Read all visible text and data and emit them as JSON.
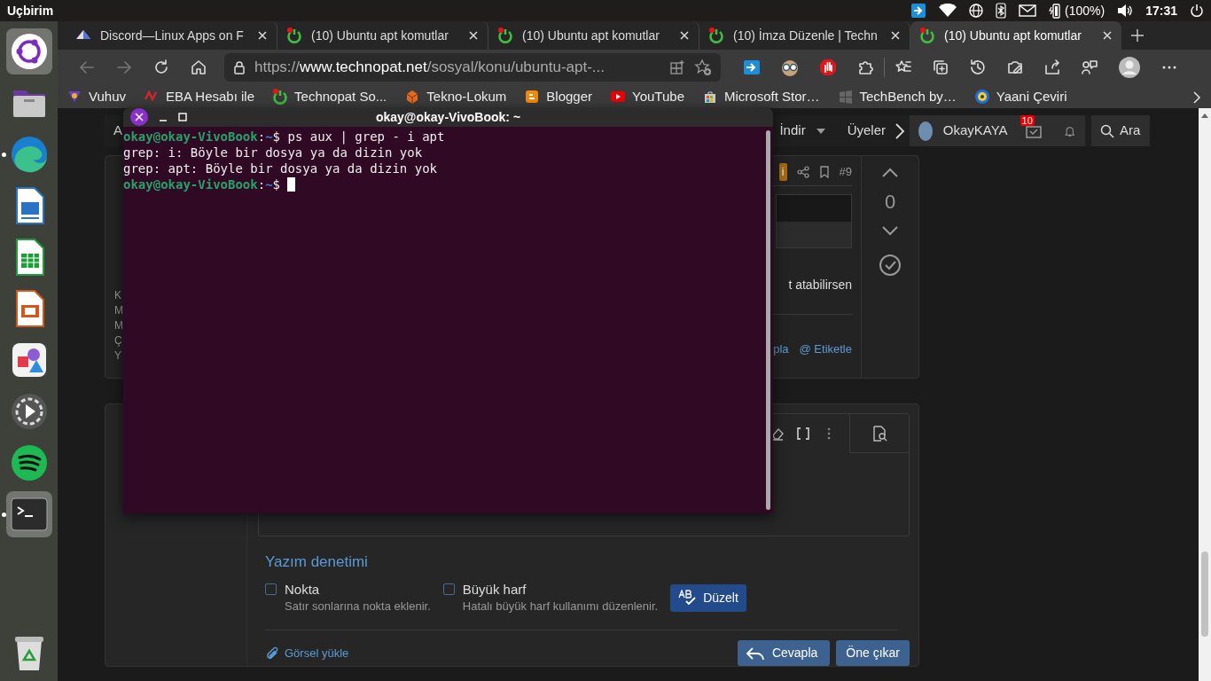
{
  "top_bar": {
    "app_title": "Uçbirim",
    "battery": "(100%)",
    "clock": "17:31"
  },
  "dock": [
    {
      "kind": "ring",
      "selected": true,
      "running": false
    },
    {
      "kind": "folder",
      "selected": false,
      "running": false
    },
    {
      "kind": "swirl",
      "selected": false,
      "running": true
    },
    {
      "kind": "writer",
      "selected": false,
      "running": false
    },
    {
      "kind": "calc",
      "selected": false,
      "running": false
    },
    {
      "kind": "impress",
      "selected": false,
      "running": false
    },
    {
      "kind": "shapes",
      "selected": false,
      "running": false
    },
    {
      "kind": "player",
      "selected": false,
      "running": false
    },
    {
      "kind": "music",
      "selected": false,
      "running": false
    },
    {
      "kind": "terminal",
      "selected": true,
      "running": true
    },
    {
      "kind": "trash",
      "selected": false,
      "running": false
    }
  ],
  "browser": {
    "tabs": [
      {
        "title": "Discord—Linux Apps on F",
        "kind": "store",
        "selected": false
      },
      {
        "title": "(10) Ubuntu apt komutlar",
        "kind": "forum",
        "selected": false
      },
      {
        "title": "(10) Ubuntu apt komutlar",
        "kind": "forum",
        "selected": false
      },
      {
        "title": "(10) İmza Düzenle | Techn",
        "kind": "forum",
        "selected": false
      },
      {
        "title": "(10) Ubuntu apt komutlar",
        "kind": "forum",
        "selected": true
      }
    ],
    "address": {
      "scheme": "https://",
      "host": "www.technopat.net",
      "path": "/sosyal/konu/ubuntu-apt-..."
    },
    "bookmarks": [
      {
        "label": "Vuhuv",
        "kind": "vuhuv"
      },
      {
        "label": "EBA Hesabı ile",
        "kind": "eba"
      },
      {
        "label": "Technopat So...",
        "kind": "forum"
      },
      {
        "label": "Tekno-Lokum",
        "kind": "box"
      },
      {
        "label": "Blogger",
        "kind": "blogger"
      },
      {
        "label": "YouTube",
        "kind": "youtube"
      },
      {
        "label": "Microsoft Stor…",
        "kind": "store"
      },
      {
        "label": "TechBench by…",
        "kind": "windows"
      },
      {
        "label": "Yaani Çeviri",
        "kind": "yaani"
      }
    ]
  },
  "site": {
    "nav": [
      {
        "label": "A",
        "dropdown": false
      },
      {
        "label": "İndir",
        "dropdown": true
      },
      {
        "label": "Üyeler",
        "dropdown": false
      }
    ],
    "user": {
      "name": "OkayKAYA",
      "badge": "10"
    },
    "search": "Ara",
    "post": {
      "user_info": [
        "K",
        "M",
        "M",
        "Ç",
        "Y"
      ],
      "tag": "i",
      "number": "#9",
      "text": "t atabilirsen",
      "actions": [
        "pla",
        "@ Etiketle"
      ],
      "votes": "0"
    },
    "reply": {
      "spell_title": "Yazım denetimi",
      "options": [
        {
          "label": "Nokta",
          "hint": "Satır sonlarına nokta eklenir.",
          "checked": false
        },
        {
          "label": "Büyük harf",
          "hint": "Hatalı büyük harf kullanımı düzenlenir.",
          "checked": false
        }
      ],
      "fix_button": "Düzelt",
      "upload": "Görsel yükle",
      "buttons": [
        {
          "label": "Cevapla",
          "kind": "reply"
        },
        {
          "label": "Öne çıkar",
          "kind": "plain"
        }
      ]
    }
  },
  "terminal": {
    "title": "okay@okay-VivoBook: ~",
    "lines": [
      {
        "kind": "prompt",
        "user": "okay@okay-VivoBook",
        "separator": ":",
        "cwd": "~",
        "symbol": "$",
        "command": "ps aux | grep - i apt",
        "cursor": false
      },
      {
        "kind": "output",
        "text": "grep: i: Böyle bir dosya ya da dizin yok"
      },
      {
        "kind": "output",
        "text": "grep: apt: Böyle bir dosya ya da dizin yok"
      },
      {
        "kind": "prompt",
        "user": "okay@okay-VivoBook",
        "separator": ":",
        "cwd": "~",
        "symbol": "$",
        "cursor": true
      }
    ]
  }
}
